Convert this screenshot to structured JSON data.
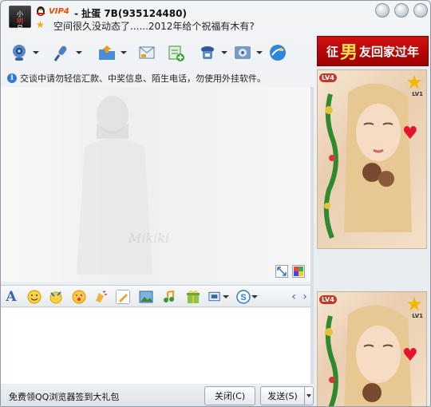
{
  "titlebar": {
    "vip_label": "VIP4",
    "contact_name": "- 扯蛋 7B(935124480)",
    "signature": "空间很久没动态了......2012年给个祝福有木有?"
  },
  "toolbar": {
    "items": [
      {
        "icon": "video-call-icon",
        "has_menu": true
      },
      {
        "icon": "voice-call-icon",
        "has_menu": true
      },
      {
        "icon": "send-file-icon",
        "has_menu": true
      },
      {
        "icon": "send-sms-icon",
        "has_menu": false
      },
      {
        "icon": "create-group-icon",
        "has_menu": false
      },
      {
        "icon": "remote-assist-icon",
        "has_menu": true
      },
      {
        "icon": "app-settings-icon",
        "has_menu": true
      },
      {
        "icon": "browser-icon",
        "has_menu": false
      }
    ]
  },
  "notice": {
    "text": "交谈中请勿轻信汇款、中奖信息、陌生电话，勿使用外挂软件。"
  },
  "chat_area": {
    "watermark": "Mikiki"
  },
  "input_toolbar": {
    "items": [
      "font-icon",
      "emoticon-icon",
      "magic-emoticon-icon",
      "wink-icon",
      "shake-icon",
      "doodle-icon",
      "image-icon",
      "music-icon",
      "gift-icon",
      "screenshot-icon",
      "payment-icon"
    ]
  },
  "bottom_bar": {
    "promo_text": "免费领QQ浏览器签到大礼包",
    "close_label": "关闭(C)",
    "send_label": "发送(S)"
  },
  "ad_panel": {
    "banner_prefix": "征",
    "banner_big": "男",
    "banner_suffix": "友回家过年",
    "show_level": "LV4",
    "star_level": "LV1"
  },
  "colors": {
    "window_bg": "#e6ebef",
    "banner_red": "#c00000",
    "vip_orange": "#e94d00"
  }
}
